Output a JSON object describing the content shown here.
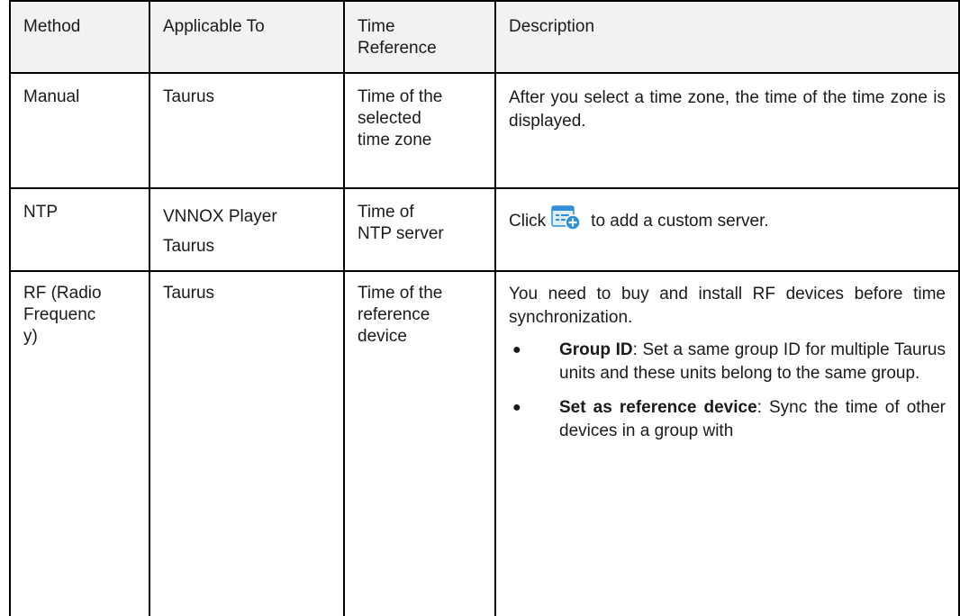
{
  "table": {
    "headers": {
      "method": "Method",
      "applicable_to": "Applicable To",
      "time_reference_line1": "Time",
      "time_reference_line2": "Reference",
      "description": "Description"
    },
    "rows": [
      {
        "method": "Manual",
        "applicable_to": "Taurus",
        "time_reference_lines": [
          "Time of the",
          "selected",
          "time zone"
        ],
        "description": "After you select a time zone, the time of the time zone is displayed."
      },
      {
        "method": "NTP",
        "applicable_to_lines": [
          "VNNOX Player",
          "Taurus"
        ],
        "time_reference_lines": [
          "Time of",
          "NTP server"
        ],
        "description_prefix": "Click",
        "description_icon": "add-server-icon",
        "description_suffix": "to add a custom server."
      },
      {
        "method_lines": [
          "RF (Radio",
          "Frequenc",
          "y)"
        ],
        "applicable_to": "Taurus",
        "time_reference_lines": [
          "Time of the",
          "reference",
          "device"
        ],
        "description": "You need to buy and install RF devices before time synchronization.",
        "bullets": [
          {
            "term": "Group ID",
            "text": ": Set a same group ID for multiple Taurus units and these units belong to the same group."
          },
          {
            "term": "Set as reference device",
            "text": ": Sync the time of other devices in a group with"
          }
        ]
      }
    ]
  },
  "colors": {
    "border": "#000000",
    "header_bg": "#f2f2f2",
    "icon_blue": "#2f8fd8"
  }
}
